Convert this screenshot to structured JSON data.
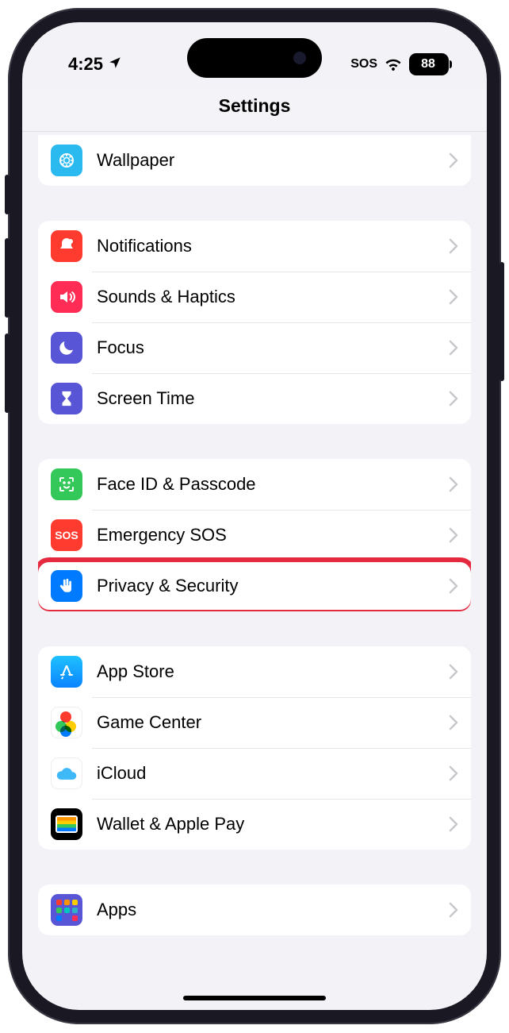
{
  "status": {
    "time": "4:25",
    "sos": "SOS",
    "battery": "88"
  },
  "header": {
    "title": "Settings"
  },
  "groups": [
    {
      "rows": [
        {
          "icon_name": "wallpaper-icon",
          "label": "Wallpaper"
        }
      ]
    },
    {
      "rows": [
        {
          "icon_name": "bell-icon",
          "label": "Notifications"
        },
        {
          "icon_name": "speaker-icon",
          "label": "Sounds & Haptics"
        },
        {
          "icon_name": "moon-icon",
          "label": "Focus"
        },
        {
          "icon_name": "hourglass-icon",
          "label": "Screen Time"
        }
      ]
    },
    {
      "rows": [
        {
          "icon_name": "face-id-icon",
          "label": "Face ID & Passcode"
        },
        {
          "icon_name": "sos-icon",
          "label": "Emergency SOS",
          "icon_text": "SOS"
        },
        {
          "icon_name": "hand-icon",
          "label": "Privacy & Security",
          "highlighted": true
        }
      ]
    },
    {
      "rows": [
        {
          "icon_name": "appstore-icon",
          "label": "App Store"
        },
        {
          "icon_name": "gamecenter-icon",
          "label": "Game Center"
        },
        {
          "icon_name": "icloud-icon",
          "label": "iCloud"
        },
        {
          "icon_name": "wallet-icon",
          "label": "Wallet & Apple Pay"
        }
      ]
    },
    {
      "rows": [
        {
          "icon_name": "apps-icon",
          "label": "Apps"
        }
      ]
    }
  ],
  "highlight_color": "#e52a3f"
}
